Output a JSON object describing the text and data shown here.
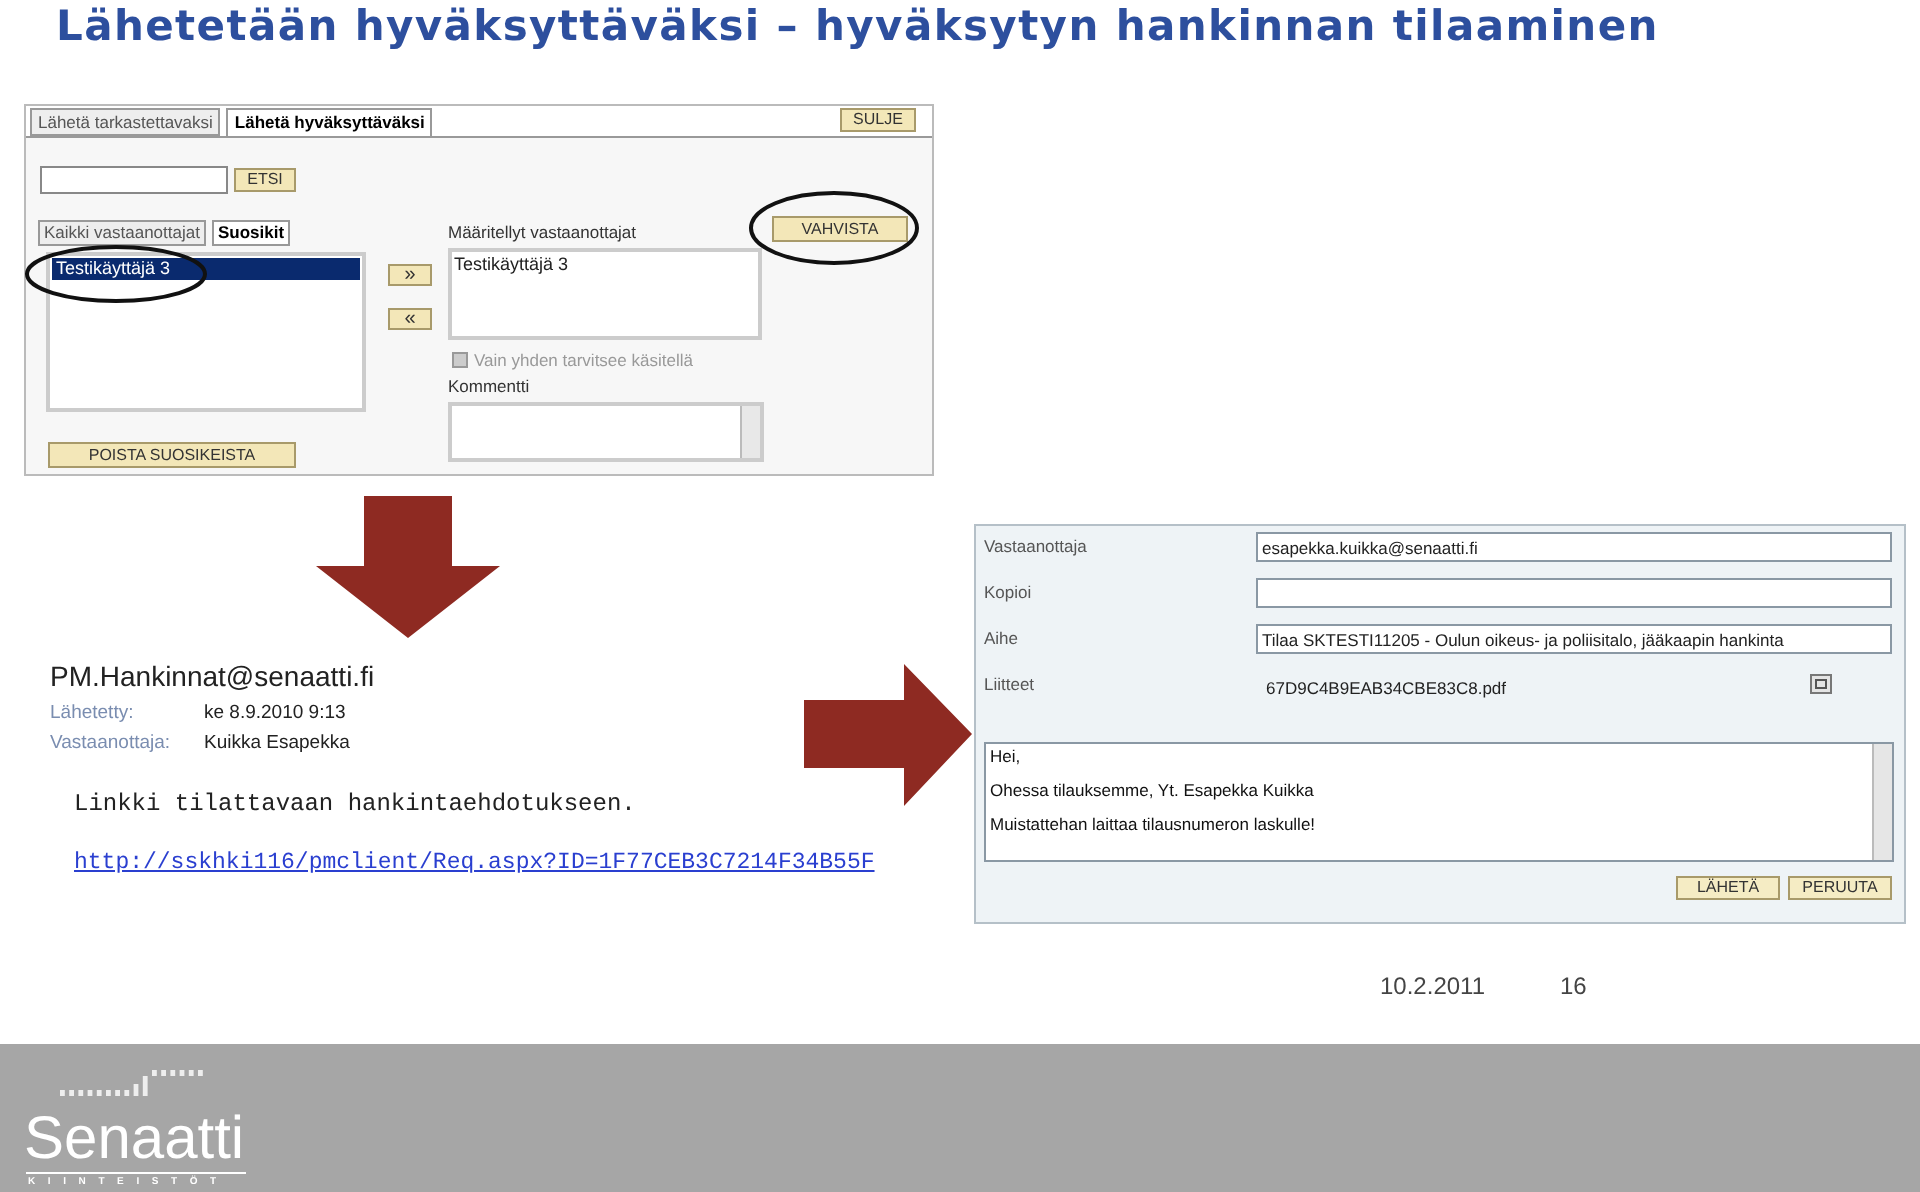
{
  "title": "Lähetetään hyväksyttäväksi – hyväksytyn hankinnan tilaaminen",
  "approval_dialog": {
    "tabs": [
      {
        "label": "Lähetä tarkastettavaksi",
        "selected": false
      },
      {
        "label": "Lähetä hyväksyttäväksi",
        "selected": true
      }
    ],
    "close_button": "SULJE",
    "search_button": "ETSI",
    "recipient_tabs": [
      {
        "label": "Kaikki vastaanottajat",
        "selected": false
      },
      {
        "label": "Suosikit",
        "selected": true
      }
    ],
    "favorites": [
      {
        "label": "Testikäyttäjä 3",
        "selected": true
      }
    ],
    "add_button": "»",
    "remove_button": "«",
    "defined_label": "Määritellyt vastaanottajat",
    "defined_recipients": [
      "Testikäyttäjä 3"
    ],
    "confirm_button": "VAHVISTA",
    "only_one_checkbox": {
      "label": "Vain yhden tarvitsee käsitellä",
      "checked": false,
      "disabled": true
    },
    "comment_label": "Kommentti",
    "remove_favorites_button": "POISTA SUOSIKEISTA"
  },
  "email": {
    "sender": "PM.Hankinnat@senaatti.fi",
    "fields": [
      {
        "label": "Lähetetty:",
        "value": "ke 8.9.2010 9:13"
      },
      {
        "label": "Vastaanottaja:",
        "value": "Kuikka Esapekka"
      }
    ],
    "body": "Linkki tilattavaan hankintaehdotukseen.",
    "link": "http://sskhki116/pmclient/Req.aspx?ID=1F77CEB3C7214F34B55F"
  },
  "order_form": {
    "fields": [
      {
        "label": "Vastaanottaja",
        "value": "esapekka.kuikka@senaatti.fi"
      },
      {
        "label": "Kopioi"
      },
      {
        "label": "Aihe",
        "value": "Tilaa SKTESTI11205 - Oulun oikeus- ja poliisitalo, jääkaapin hankinta"
      }
    ],
    "attachments_label": "Liitteet",
    "attachment": "67D9C4B9EAB34CBE83C8.pdf",
    "message": [
      "Hei,",
      "Ohessa tilauksemme, Yt. Esapekka Kuikka",
      "Muistattehan laittaa tilausnumeron laskulle!"
    ],
    "buttons": [
      "LÄHETÄ",
      "PERUUTA"
    ]
  },
  "footer": {
    "date": "10.2.2011",
    "page": "16",
    "logo": "Senaatti",
    "logo_subtitle": "KIINTEISTÖT"
  }
}
